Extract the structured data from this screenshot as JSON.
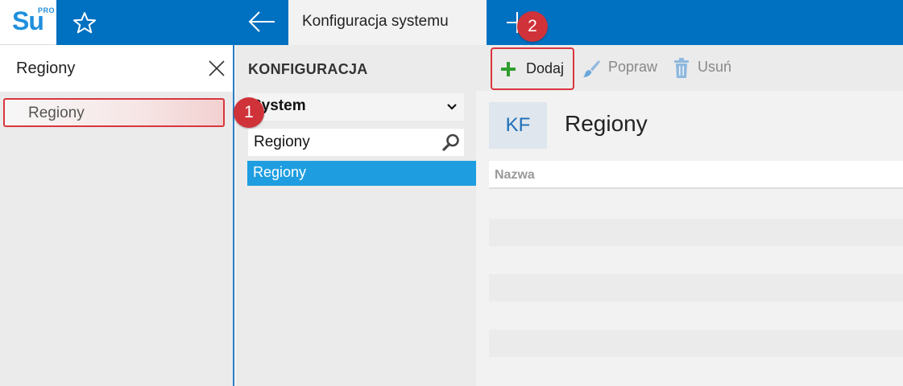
{
  "app": {
    "logo_text": "Su",
    "logo_badge": "PRO",
    "active_tab": "Konfiguracja systemu"
  },
  "left": {
    "search_value": "Regiony",
    "result_label": "Regiony"
  },
  "middle": {
    "title": "KONFIGURACJA",
    "select_value": "System",
    "search_value": "Regiony",
    "selected_item": "Regiony"
  },
  "toolbar": {
    "add_label": "Dodaj",
    "edit_label": "Popraw",
    "delete_label": "Usuń"
  },
  "content": {
    "badge": "KF",
    "title": "Regiony",
    "column_header": "Nazwa",
    "rows": []
  },
  "annotations": [
    "1",
    "2"
  ],
  "colors": {
    "brand_blue": "#0070c0",
    "selection_blue": "#1e9ee0",
    "annotation_red": "#d0323a",
    "add_green": "#2e9e2e"
  },
  "icons": [
    "star-icon",
    "back-arrow-icon",
    "plus-icon",
    "close-icon",
    "chevron-down-icon",
    "search-icon",
    "add-icon",
    "brush-icon",
    "trash-icon"
  ]
}
